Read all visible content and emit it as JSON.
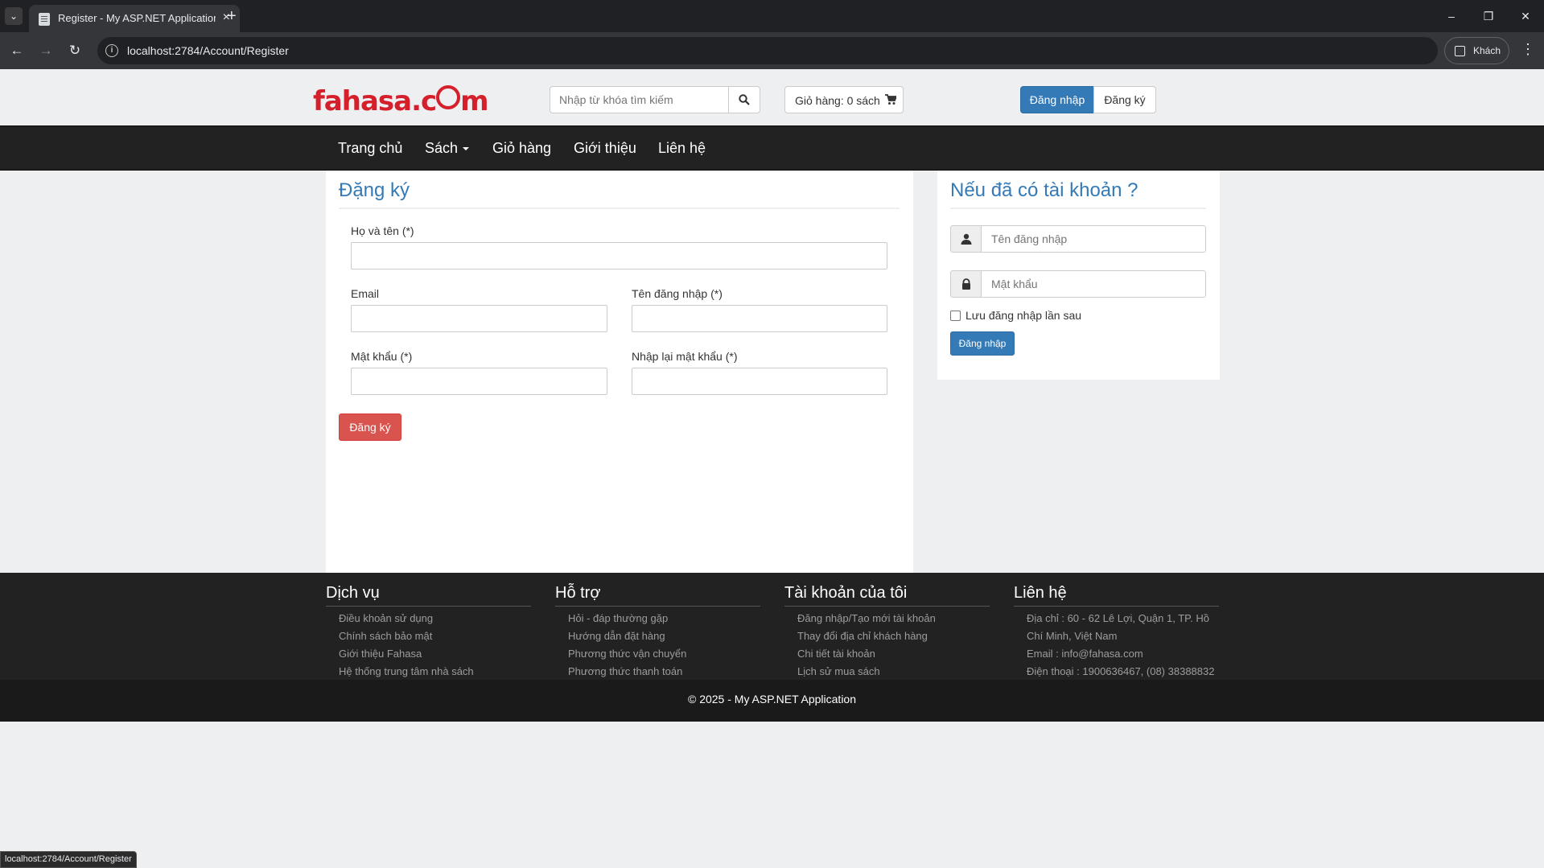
{
  "browser": {
    "tab_title": "Register - My ASP.NET Application",
    "url": "localhost:2784/Account/Register",
    "profile_label": "Khách",
    "status_url": "localhost:2784/Account/Register"
  },
  "header": {
    "logo_text_left": "fahasa.c",
    "logo_text_right": "m",
    "search_placeholder": "Nhập từ khóa tìm kiếm",
    "cart_label": "Giỏ hàng: 0 sách",
    "login_label": "Đăng nhập",
    "register_label": "Đăng ký"
  },
  "nav": {
    "items": [
      "Trang chủ",
      "Sách",
      "Giỏ hàng",
      "Giới thiệu",
      "Liên hệ"
    ]
  },
  "register": {
    "title": "Đặng ký",
    "fullname_label": "Họ và tên (*)",
    "email_label": "Email",
    "username_label": "Tên đăng nhập (*)",
    "password_label": "Mật khẩu (*)",
    "confirm_label": "Nhập lại mật khẩu (*)",
    "submit_label": "Đăng ký"
  },
  "login": {
    "title": "Nếu đã có tài khoản ?",
    "username_placeholder": "Tên đăng nhập",
    "password_placeholder": "Mật khẩu",
    "remember_label": "Lưu đăng nhập lần sau",
    "submit_label": "Đăng nhập"
  },
  "footer": {
    "columns": [
      {
        "heading": "Dịch vụ",
        "items": [
          "Điều khoản sử dụng",
          "Chính sách bảo mật",
          "Giới thiệu Fahasa",
          "Hệ thống trung tâm nhà sách"
        ]
      },
      {
        "heading": "Hỗ trợ",
        "items": [
          "Hỏi - đáp thường gặp",
          "Hướng dẫn đặt hàng",
          "Phương thức vận chuyển",
          "Phương thức thanh toán"
        ]
      },
      {
        "heading": "Tài khoản của tôi",
        "items": [
          "Đăng nhập/Tạo mới tài khoản",
          "Thay đổi địa chỉ khách hàng",
          "Chi tiết tài khoản",
          "Lịch sử mua sách"
        ]
      },
      {
        "heading": "Liên hệ",
        "items": [
          "Địa chỉ : 60 - 62 Lê Lợi, Quận 1, TP. Hồ Chí Minh, Việt Nam",
          "Email : info@fahasa.com",
          "Điện thoại : 1900636467, (08) 38388832"
        ]
      }
    ],
    "copyright": "© 2025 - My ASP.NET Application"
  },
  "colors": {
    "brand_red": "#d5202c",
    "primary_blue": "#337ab7",
    "danger_red": "#d9534f",
    "navbar_dark": "#222222"
  }
}
